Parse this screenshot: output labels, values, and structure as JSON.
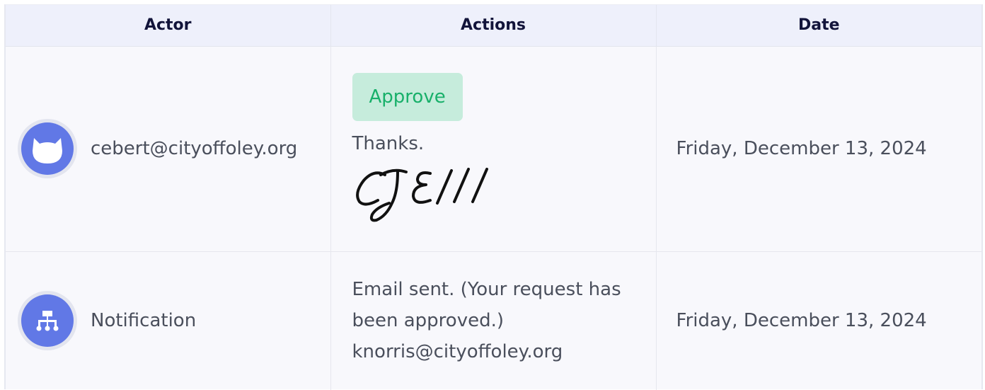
{
  "table": {
    "headers": [
      "Actor",
      "Actions",
      "Date"
    ],
    "rows": [
      {
        "actor": "cebert@cityoffoley.org",
        "actor_icon": "cat-icon",
        "action_badge": "Approve",
        "action_comment": "Thanks.",
        "signature": "CJEIII",
        "date": "Friday, December 13, 2024"
      },
      {
        "actor": "Notification",
        "actor_icon": "workflow-icon",
        "action_line1": "Email sent. (Your request has",
        "action_line2": "been approved.)",
        "action_line3": "knorris@cityoffoley.org",
        "date": "Friday, December 13, 2024"
      }
    ]
  },
  "colors": {
    "avatar": "#6178e6",
    "approve_bg": "#c6ecdc",
    "approve_text": "#18b06a",
    "header_bg": "#eef0fb"
  }
}
